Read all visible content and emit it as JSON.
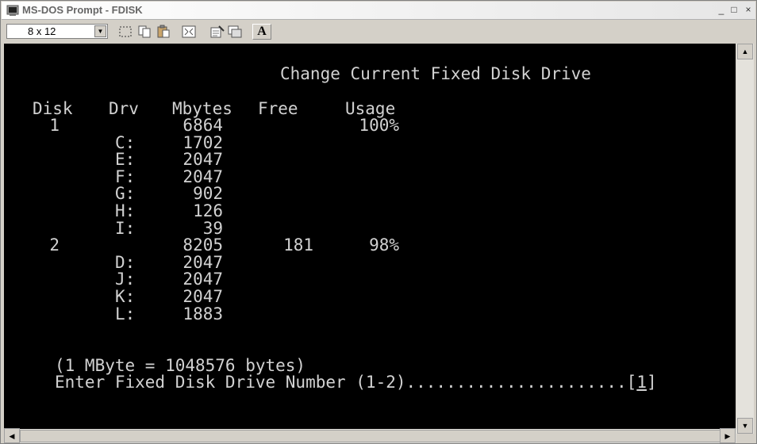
{
  "window": {
    "title": "MS-DOS Prompt - FDISK",
    "controls": {
      "minimize": "_",
      "maximize": "□",
      "close": "×"
    }
  },
  "toolbar": {
    "font_size": "8 x 12",
    "tools": [
      "mark-icon",
      "copy-icon",
      "paste-icon",
      "fullscreen-icon",
      "properties-icon",
      "background-icon",
      "font-icon"
    ],
    "font_button_label": "A"
  },
  "terminal": {
    "heading": "Change Current Fixed Disk Drive",
    "columns": {
      "disk": "Disk",
      "drv": "Drv",
      "mbytes": "Mbytes",
      "free": "Free",
      "usage": "Usage"
    },
    "rows": [
      {
        "disk": "1",
        "drv": "",
        "mbytes": "6864",
        "free": "",
        "usage": "100%"
      },
      {
        "disk": "",
        "drv": "C:",
        "mbytes": "1702",
        "free": "",
        "usage": ""
      },
      {
        "disk": "",
        "drv": "E:",
        "mbytes": "2047",
        "free": "",
        "usage": ""
      },
      {
        "disk": "",
        "drv": "F:",
        "mbytes": "2047",
        "free": "",
        "usage": ""
      },
      {
        "disk": "",
        "drv": "G:",
        "mbytes": "902",
        "free": "",
        "usage": ""
      },
      {
        "disk": "",
        "drv": "H:",
        "mbytes": "126",
        "free": "",
        "usage": ""
      },
      {
        "disk": "",
        "drv": "I:",
        "mbytes": "39",
        "free": "",
        "usage": ""
      },
      {
        "disk": "2",
        "drv": "",
        "mbytes": "8205",
        "free": "181",
        "usage": "98%"
      },
      {
        "disk": "",
        "drv": "D:",
        "mbytes": "2047",
        "free": "",
        "usage": ""
      },
      {
        "disk": "",
        "drv": "J:",
        "mbytes": "2047",
        "free": "",
        "usage": ""
      },
      {
        "disk": "",
        "drv": "K:",
        "mbytes": "2047",
        "free": "",
        "usage": ""
      },
      {
        "disk": "",
        "drv": "L:",
        "mbytes": "1883",
        "free": "",
        "usage": ""
      }
    ],
    "note": "(1 MByte = 1048576 bytes)",
    "prompt": "Enter Fixed Disk Drive Number (1-2)......................",
    "input_open": "[",
    "input_value": "1",
    "input_close": "]"
  },
  "colors": {
    "terminal_bg": "#000000",
    "terminal_fg": "#d2d2d2",
    "chrome": "#d4d0c8"
  }
}
